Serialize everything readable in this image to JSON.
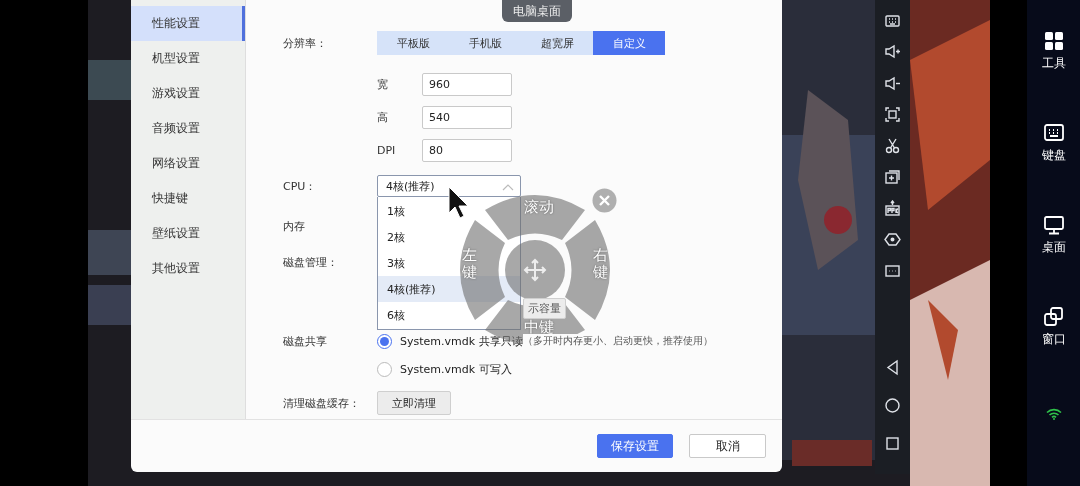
{
  "overlay_title": "电脑桌面",
  "sidebar": {
    "items": [
      {
        "label": "性能设置",
        "selected": true
      },
      {
        "label": "机型设置",
        "selected": false
      },
      {
        "label": "游戏设置",
        "selected": false
      },
      {
        "label": "音频设置",
        "selected": false
      },
      {
        "label": "网络设置",
        "selected": false
      },
      {
        "label": "快捷键",
        "selected": false
      },
      {
        "label": "壁纸设置",
        "selected": false
      },
      {
        "label": "其他设置",
        "selected": false
      }
    ]
  },
  "settings": {
    "resolution": {
      "label": "分辨率：",
      "options": [
        {
          "label": "平板版",
          "selected": false
        },
        {
          "label": "手机版",
          "selected": false
        },
        {
          "label": "超宽屏",
          "selected": false
        },
        {
          "label": "自定义",
          "selected": true
        }
      ]
    },
    "custom_fields": [
      {
        "label": "宽",
        "value": "960"
      },
      {
        "label": "高",
        "value": "540"
      },
      {
        "label": "DPI",
        "value": "80"
      }
    ],
    "cpu": {
      "label": "CPU：",
      "value": "4核(推荐)",
      "expanded": true,
      "options": [
        {
          "label": "1核",
          "selected": false
        },
        {
          "label": "2核",
          "selected": false
        },
        {
          "label": "3核",
          "selected": false
        },
        {
          "label": "4核(推荐)",
          "selected": true
        },
        {
          "label": "6核",
          "selected": false
        }
      ]
    },
    "memory": {
      "label": "内存"
    },
    "disk_management": {
      "label": "磁盘管理：",
      "button": "示容量"
    },
    "disk_sharing": {
      "label": "磁盘共享",
      "options": [
        {
          "label": "System.vmdk 共享只读",
          "note": "（多开时内存更小、启动更快，推荐使用）",
          "selected": true
        },
        {
          "label": "System.vmdk 可写入",
          "selected": false
        }
      ]
    },
    "clear_cache": {
      "label": "清理磁盘缓存：",
      "button": "立即清理"
    }
  },
  "footer": {
    "buttons": [
      {
        "label": "保存设置",
        "kind": "primary"
      },
      {
        "label": "取消",
        "kind": "default"
      }
    ]
  },
  "joystick": {
    "up": "滚动",
    "left": "左键",
    "right": "右键",
    "down": "中键"
  },
  "right_panel": {
    "items": [
      {
        "label": "工具"
      },
      {
        "label": "键盘"
      },
      {
        "label": "桌面"
      },
      {
        "label": "窗口"
      }
    ]
  }
}
